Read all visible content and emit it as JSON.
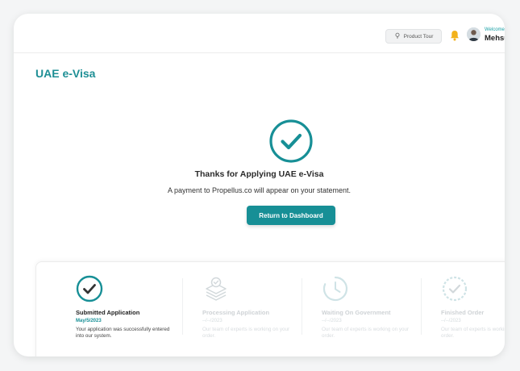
{
  "header": {
    "product_tour_label": "Product Tour",
    "welcome_text": "Welcome",
    "user_name": "Mehsum"
  },
  "page": {
    "title": "UAE e-Visa"
  },
  "confirmation": {
    "heading": "Thanks for Applying UAE e-Visa",
    "message": "A payment to Propellus.co will appear on your statement.",
    "button_label": "Return to Dashboard"
  },
  "steps": [
    {
      "title": "Submitted Application",
      "date": "May/5/2023",
      "description": "Your application was successfully entered into our system.",
      "icon": "check-circle-icon",
      "status": "complete"
    },
    {
      "title": "Processing Application",
      "date": "--/--/2023",
      "description": "Our team of experts is working on your order.",
      "icon": "document-stack-icon",
      "status": "pending"
    },
    {
      "title": "Waiting On Government",
      "date": "--/--/2023",
      "description": "Our team of experts is working on your order.",
      "icon": "clock-icon",
      "status": "pending"
    },
    {
      "title": "Finished Order",
      "date": "--/--/2023",
      "description": "Our team of experts is working on your order.",
      "icon": "check-badge-icon",
      "status": "pending"
    }
  ],
  "colors": {
    "accent": "#178f96",
    "title": "#1e8f95",
    "bell": "#f2b21b",
    "muted": "#cfd3d6"
  }
}
